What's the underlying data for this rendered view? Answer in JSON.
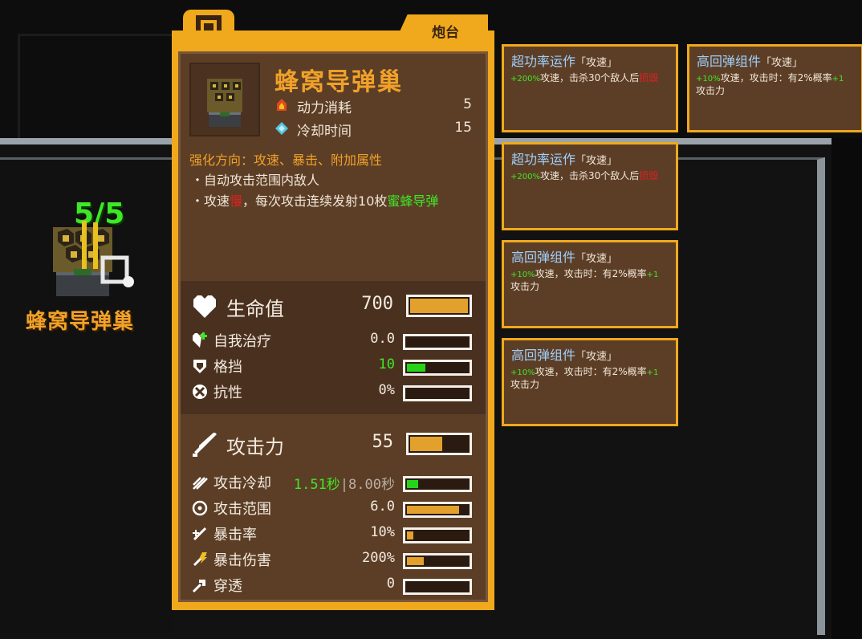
{
  "unit": {
    "count": "5/5",
    "name": "蜂窝导弹巢"
  },
  "card": {
    "type": "炮台",
    "title": "蜂窝导弹巢",
    "props": [
      {
        "icon": "power-icon",
        "label": "动力消耗",
        "value": "5"
      },
      {
        "icon": "cooldown-gem-icon",
        "label": "冷却时间",
        "value": "15"
      }
    ],
    "upgrade_direction": "强化方向：攻速、暴击、附加属性",
    "bullets": [
      {
        "prefix": "・自动攻击范围内敌人",
        "red": "",
        "middle": "",
        "green": ""
      },
      {
        "prefix": "・攻速",
        "red": "慢",
        "middle": "，每次攻击连续发射10枚",
        "green": "蜜蜂导弹"
      }
    ],
    "hp": {
      "label": "生命值",
      "value": "700",
      "fill": 1.0,
      "rows": [
        {
          "icon": "heal-icon",
          "label": "自我治疗",
          "value": "0.0",
          "fill": 0.0,
          "color": "#e2a12c"
        },
        {
          "icon": "shield-icon",
          "label": "格挡",
          "value": "10",
          "fill": 0.3,
          "color": "#27d31a",
          "value_color": "#3ee826"
        },
        {
          "icon": "resist-icon",
          "label": "抗性",
          "value": "0%",
          "fill": 0.0,
          "color": "#e2a12c"
        }
      ]
    },
    "attack": {
      "label": "攻击力",
      "value": "55",
      "fill": 0.55,
      "rows": [
        {
          "icon": "attack-cooldown-icon",
          "label": "攻击冷却",
          "value_green": "1.51秒",
          "value_rest": "|8.00秒",
          "fill": 0.19,
          "color": "#27d31a"
        },
        {
          "icon": "range-icon",
          "label": "攻击范围",
          "value": "6.0",
          "fill": 0.85,
          "color": "#e2a12c"
        },
        {
          "icon": "crit-rate-icon",
          "label": "暴击率",
          "value": "10%",
          "fill": 0.1,
          "color": "#e2a12c"
        },
        {
          "icon": "crit-damage-icon",
          "label": "暴击伤害",
          "value": "200%",
          "fill": 0.28,
          "color": "#e2a12c"
        },
        {
          "icon": "pierce-icon",
          "label": "穿透",
          "value": "0",
          "fill": 0.0,
          "color": "#e2a12c"
        }
      ]
    }
  },
  "mods": [
    {
      "title": "超功率运作",
      "tag": "「攻速」",
      "green": "+200%",
      "text": "攻速，击杀30个敌人后",
      "red": "损毁"
    },
    {
      "title": "高回弹组件",
      "tag": "「攻速」",
      "green": "+10%",
      "text": "攻速，攻击时：有2%概率",
      "green2": "+1",
      "text2": "攻击力"
    },
    {
      "title": "超功率运作",
      "tag": "「攻速」",
      "green": "+200%",
      "text": "攻速，击杀30个敌人后",
      "red": "损毁"
    },
    {
      "title": "高回弹组件",
      "tag": "「攻速」",
      "green": "+10%",
      "text": "攻速，攻击时：有2%概率",
      "green2": "+1",
      "text2": "攻击力"
    },
    {
      "title": "高回弹组件",
      "tag": "「攻速」",
      "green": "+10%",
      "text": "攻速，攻击时：有2%概率",
      "green2": "+1",
      "text2": "攻击力"
    }
  ]
}
